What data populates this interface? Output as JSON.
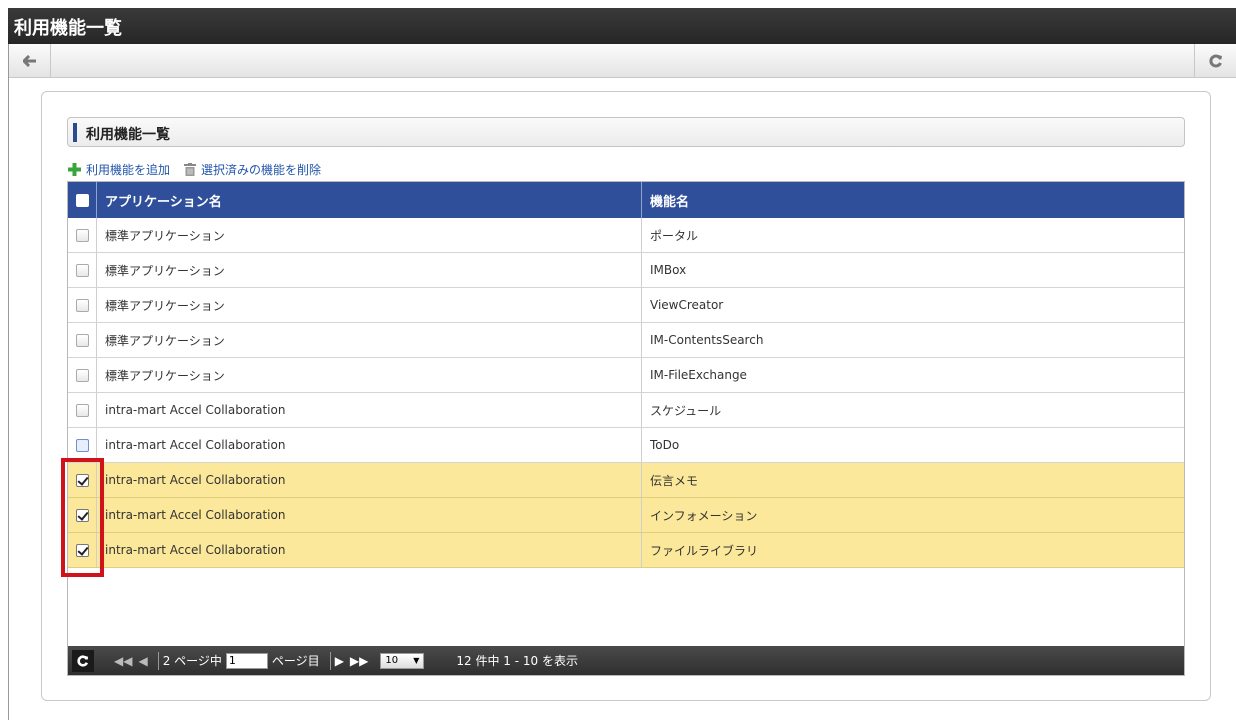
{
  "window": {
    "title": "利用機能一覧"
  },
  "toolbar": {
    "back_icon": "arrow-left-icon",
    "reload_icon": "reload-icon"
  },
  "section": {
    "title": "利用機能一覧"
  },
  "actions": {
    "add_label": "利用機能を追加",
    "delete_label": "選択済みの機能を削除"
  },
  "grid": {
    "columns": {
      "app": "アプリケーション名",
      "func": "機能名"
    },
    "rows": [
      {
        "app": "標準アプリケーション",
        "func": "ポータル",
        "checked": false
      },
      {
        "app": "標準アプリケーション",
        "func": "IMBox",
        "checked": false
      },
      {
        "app": "標準アプリケーション",
        "func": "ViewCreator",
        "checked": false
      },
      {
        "app": "標準アプリケーション",
        "func": "IM-ContentsSearch",
        "checked": false
      },
      {
        "app": "標準アプリケーション",
        "func": "IM-FileExchange",
        "checked": false
      },
      {
        "app": "intra-mart Accel Collaboration",
        "func": "スケジュール",
        "checked": false
      },
      {
        "app": "intra-mart Accel Collaboration",
        "func": "ToDo",
        "checked": false
      },
      {
        "app": "intra-mart Accel Collaboration",
        "func": "伝言メモ",
        "checked": true
      },
      {
        "app": "intra-mart Accel Collaboration",
        "func": "インフォメーション",
        "checked": true
      },
      {
        "app": "intra-mart Accel Collaboration",
        "func": "ファイルライブラリ",
        "checked": true
      }
    ]
  },
  "pager": {
    "total_pages_label": "2 ページ中",
    "page_value": "1",
    "page_suffix": "ページ目",
    "rows_per_page": "10",
    "summary": "12 件中 1 - 10 を表示"
  },
  "colors": {
    "header": "#2f4f9a",
    "selected_row": "#fbe89a",
    "highlight": "#d0121b"
  }
}
